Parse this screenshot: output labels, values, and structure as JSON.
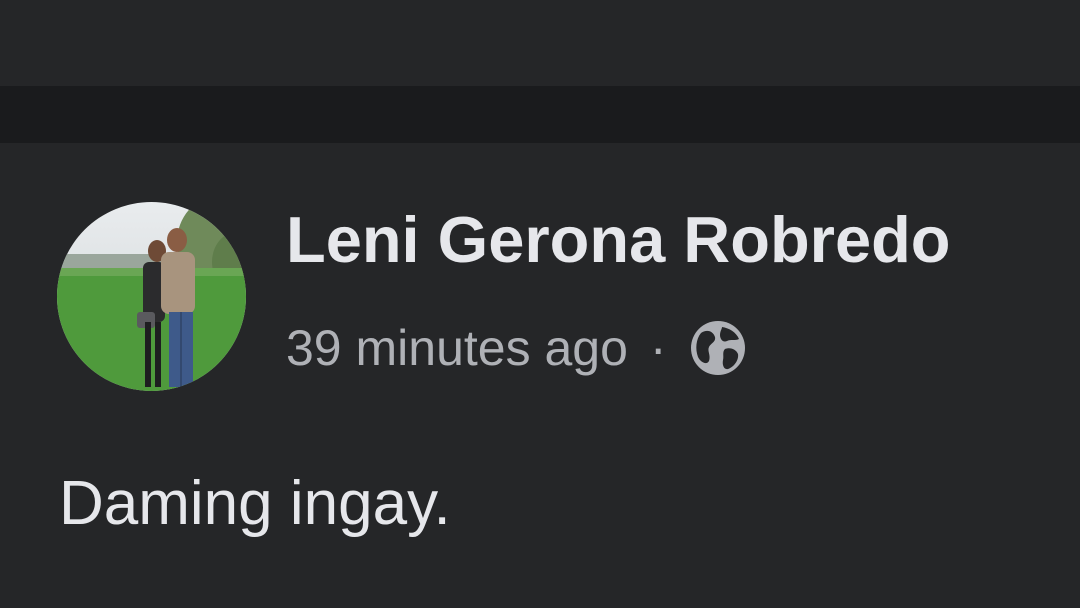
{
  "post": {
    "author_name": "Leni Gerona Robredo",
    "timestamp": "39 minutes ago",
    "separator": "·",
    "audience_icon": "globe-icon",
    "text": "Daming ingay."
  },
  "colors": {
    "background": "#252628",
    "separator_band": "#1a1b1d",
    "primary_text": "#e6e7eb",
    "secondary_text": "#afb1b6"
  }
}
